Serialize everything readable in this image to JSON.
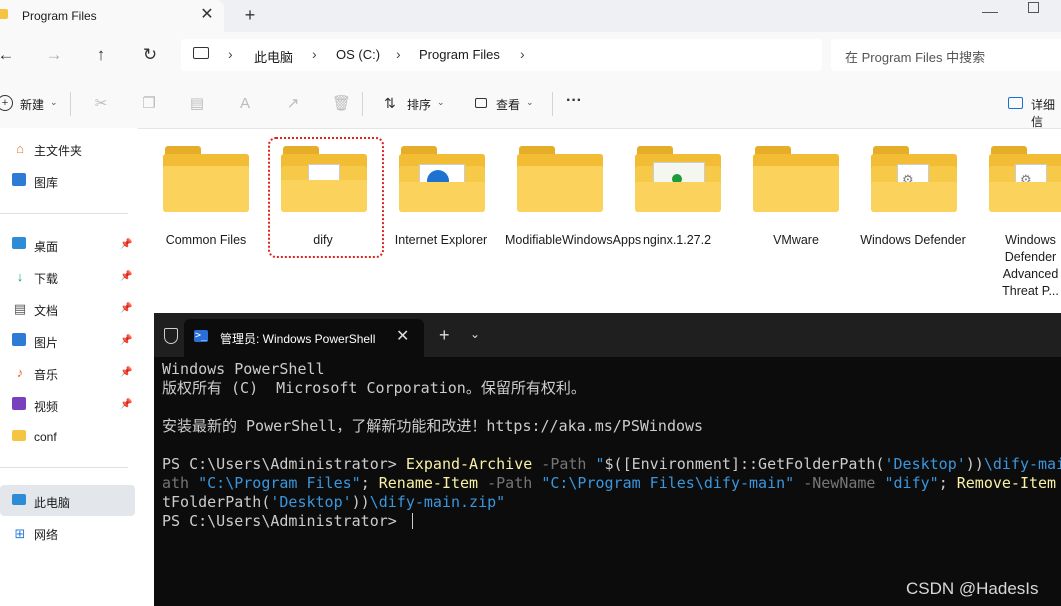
{
  "tab": {
    "title": "Program Files",
    "close": "✕",
    "new": "+"
  },
  "nav": {
    "back": "←",
    "forward": "→",
    "up": "↑",
    "refresh": "↻",
    "crumbs": [
      "此电脑",
      "OS (C:)",
      "Program Files"
    ],
    "sep": "›",
    "search_placeholder": "在 Program Files 中搜索"
  },
  "toolbar": {
    "new": "新建",
    "sort": "排序",
    "view": "查看",
    "more": "···",
    "details": "详细信"
  },
  "sidebar": {
    "items": [
      {
        "label": "主文件夹",
        "icon": "home-icon"
      },
      {
        "label": "图库",
        "icon": "gallery-icon"
      },
      {
        "label": "桌面",
        "icon": "desktop-icon",
        "pinned": true
      },
      {
        "label": "下载",
        "icon": "download-icon",
        "pinned": true
      },
      {
        "label": "文档",
        "icon": "documents-icon",
        "pinned": true
      },
      {
        "label": "图片",
        "icon": "pictures-icon",
        "pinned": true
      },
      {
        "label": "音乐",
        "icon": "music-icon",
        "pinned": true
      },
      {
        "label": "视频",
        "icon": "videos-icon",
        "pinned": true
      },
      {
        "label": "conf",
        "icon": "folder-icon"
      },
      {
        "label": "此电脑",
        "icon": "this-pc-icon"
      },
      {
        "label": "网络",
        "icon": "network-icon"
      }
    ]
  },
  "folders": [
    {
      "label": "Common Files"
    },
    {
      "label": "dify"
    },
    {
      "label": "Internet Explorer"
    },
    {
      "label": "ModifiableWindowsApps"
    },
    {
      "label": "nginx.1.27.2"
    },
    {
      "label": "VMware"
    },
    {
      "label": "Windows Defender"
    },
    {
      "label": "Windows Defender Advanced Threat P..."
    }
  ],
  "terminal": {
    "tab_title": "管理员: Windows PowerShell",
    "ps_glyph": ">_",
    "close": "✕",
    "new": "+",
    "dropdown": "⌄",
    "line1": "Windows PowerShell",
    "line2": "版权所有 (C)  Microsoft Corporation。保留所有权利。",
    "line3": "安装最新的 PowerShell，了解新功能和改进！https://aka.ms/PSWindows",
    "prompt": "PS C:\\Users\\Administrator> ",
    "cmd1": "Expand-Archive",
    "p_path": " -Path ",
    "s_dq": "\"",
    "v_env": "$([Environment]::GetFolderPath(",
    "s_desktop": "'Desktop'",
    "v_close": "))",
    "s_difymain": "\\dify-mai",
    "l2_ath": "ath ",
    "s_progfiles": "\"C:\\Program Files\"",
    "semi1": "; ",
    "cmd2": "Rename-Item",
    "s_progdify": "\"C:\\Program Files\\dify-main\"",
    "p_newname": " -NewName ",
    "s_dify": "\"dify\"",
    "semi2": "; ",
    "cmd3": "Remove-Item",
    "l3_a": "tFolderPath(",
    "s_desktop2": "'Desktop'",
    "v_close2": "))",
    "s_zip": "\\dify-main.zip\"",
    "prompt2": "PS C:\\Users\\Administrator> "
  },
  "watermark": "CSDN @HadesIs"
}
